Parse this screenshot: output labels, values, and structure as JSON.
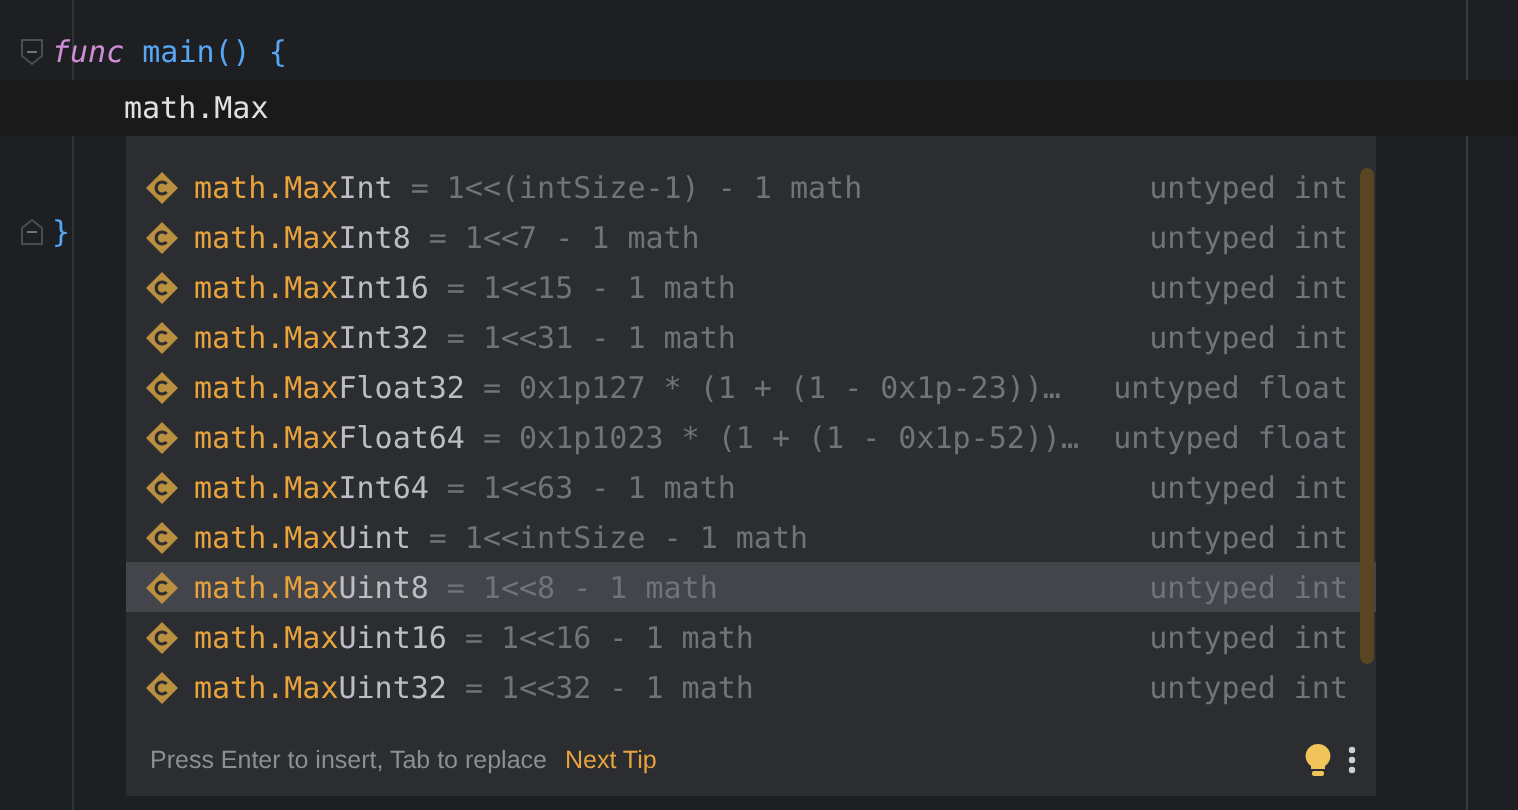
{
  "editor": {
    "lines": [
      {
        "kind": "func",
        "keyword": "func",
        "name": "main",
        "rest": "() {"
      },
      {
        "kind": "current",
        "text": "math.Max"
      },
      {
        "kind": "brace",
        "text": "}"
      }
    ]
  },
  "completion": {
    "items": [
      {
        "kind": "constant",
        "match": "math.Max",
        "rest": "Int",
        "detail": "= 1<<(intSize-1) - 1 math",
        "type": "untyped int",
        "selected": false
      },
      {
        "kind": "constant",
        "match": "math.Max",
        "rest": "Int8",
        "detail": "= 1<<7 - 1 math",
        "type": "untyped int",
        "selected": false
      },
      {
        "kind": "constant",
        "match": "math.Max",
        "rest": "Int16",
        "detail": "= 1<<15 - 1 math",
        "type": "untyped int",
        "selected": false
      },
      {
        "kind": "constant",
        "match": "math.Max",
        "rest": "Int32",
        "detail": "= 1<<31 - 1 math",
        "type": "untyped int",
        "selected": false
      },
      {
        "kind": "constant",
        "match": "math.Max",
        "rest": "Float32",
        "detail": "= 0x1p127 * (1 + (1 - 0x1p-23))…",
        "type": "untyped float",
        "selected": false
      },
      {
        "kind": "constant",
        "match": "math.Max",
        "rest": "Float64",
        "detail": "= 0x1p1023 * (1 + (1 - 0x1p-52))…",
        "type": "untyped float",
        "selected": false
      },
      {
        "kind": "constant",
        "match": "math.Max",
        "rest": "Int64",
        "detail": "= 1<<63 - 1 math",
        "type": "untyped int",
        "selected": false
      },
      {
        "kind": "constant",
        "match": "math.Max",
        "rest": "Uint",
        "detail": "= 1<<intSize - 1 math",
        "type": "untyped int",
        "selected": false
      },
      {
        "kind": "constant",
        "match": "math.Max",
        "rest": "Uint8",
        "detail": "= 1<<8 - 1 math",
        "type": "untyped int",
        "selected": true
      },
      {
        "kind": "constant",
        "match": "math.Max",
        "rest": "Uint16",
        "detail": "= 1<<16 - 1 math",
        "type": "untyped int",
        "selected": false
      },
      {
        "kind": "constant",
        "match": "math.Max",
        "rest": "Uint32",
        "detail": "= 1<<32 - 1 math",
        "type": "untyped int",
        "selected": false
      }
    ],
    "hint": "Press Enter to insert, Tab to replace",
    "link": "Next Tip"
  }
}
